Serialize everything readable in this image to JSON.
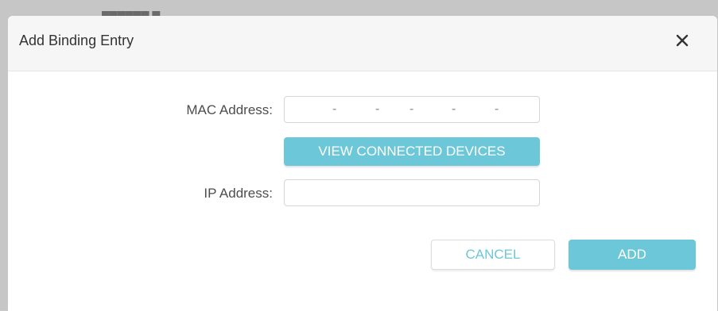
{
  "dialog": {
    "title": "Add Binding Entry",
    "close_icon": "close-icon"
  },
  "form": {
    "mac_label": "MAC Address:",
    "mac_separators": [
      "-",
      "-",
      "-",
      "-",
      "-"
    ],
    "view_devices_label": "VIEW CONNECTED DEVICES",
    "ip_label": "IP Address:",
    "ip_value": ""
  },
  "actions": {
    "cancel_label": "CANCEL",
    "add_label": "ADD"
  },
  "colors": {
    "accent": "#6cc7d9",
    "header_bg": "#f6f6f6",
    "backdrop": "#c6c6c6"
  }
}
